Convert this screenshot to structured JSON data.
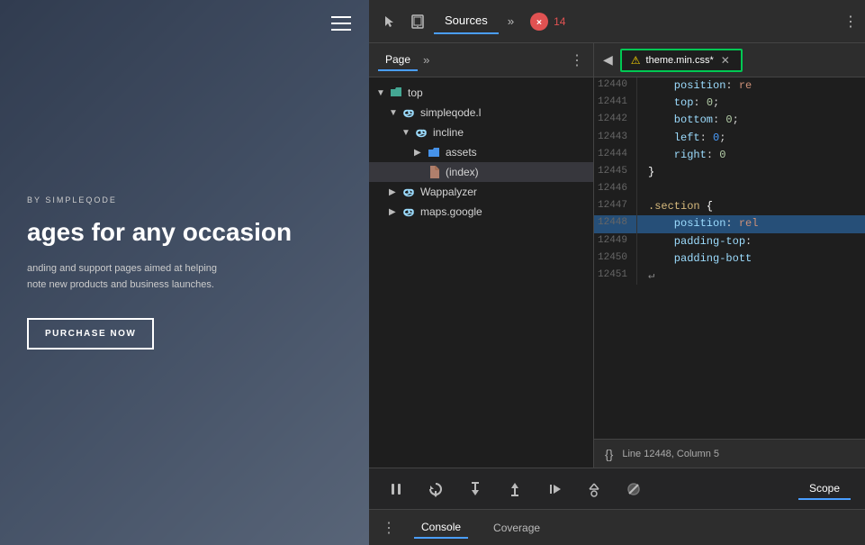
{
  "website": {
    "by_label": "BY SIMPLEQODE",
    "heading": "ages for any occasion",
    "subtext": "anding and support pages aimed at helping\nnote new products and business launches.",
    "btn_label": "PURCHASE NOW"
  },
  "devtools": {
    "toolbar": {
      "sources_tab": "Sources",
      "more_icon": "»",
      "error_icon": "✕",
      "error_count": "14",
      "dots_label": "⋮"
    },
    "file_tree": {
      "tab_page": "Page",
      "more": "»",
      "menu": "⋮",
      "items": [
        {
          "indent": 0,
          "arrow": "▼",
          "icon": "folder",
          "label": "top"
        },
        {
          "indent": 1,
          "arrow": "▼",
          "icon": "cloud",
          "label": "simpleqode.l"
        },
        {
          "indent": 2,
          "arrow": "▼",
          "icon": "cloud",
          "label": "incline"
        },
        {
          "indent": 3,
          "arrow": "▶",
          "icon": "folder-blue",
          "label": "assets"
        },
        {
          "indent": 3,
          "arrow": "",
          "icon": "file",
          "label": "(index)"
        },
        {
          "indent": 1,
          "arrow": "▶",
          "icon": "cloud",
          "label": "Wappalyzer"
        },
        {
          "indent": 1,
          "arrow": "▶",
          "icon": "cloud",
          "label": "maps.google"
        }
      ]
    },
    "code_editor": {
      "tab_label": "theme.min.css*",
      "close_label": "✕",
      "warning_icon": "⚠",
      "lines": [
        {
          "num": "12440",
          "tokens": [
            {
              "type": "prop",
              "text": "    position"
            },
            {
              "type": "punct",
              "text": ": "
            },
            {
              "type": "val-red",
              "text": "re"
            }
          ]
        },
        {
          "num": "12441",
          "tokens": [
            {
              "type": "prop",
              "text": "    top"
            },
            {
              "type": "punct",
              "text": ": "
            },
            {
              "type": "val-num",
              "text": "0"
            },
            {
              "type": "punct",
              "text": ";"
            }
          ]
        },
        {
          "num": "12442",
          "tokens": [
            {
              "type": "prop",
              "text": "    bottom"
            },
            {
              "type": "punct",
              "text": ": "
            },
            {
              "type": "val-num",
              "text": "0"
            },
            {
              "type": "punct",
              "text": ";"
            }
          ]
        },
        {
          "num": "12443",
          "tokens": [
            {
              "type": "prop",
              "text": "    left"
            },
            {
              "type": "punct",
              "text": ": "
            },
            {
              "type": "val-num",
              "text": "0"
            },
            {
              "type": "punct",
              "text": ";"
            }
          ]
        },
        {
          "num": "12444",
          "tokens": [
            {
              "type": "prop",
              "text": "    right"
            },
            {
              "type": "punct",
              "text": ": "
            },
            {
              "type": "val-num",
              "text": "0"
            }
          ]
        },
        {
          "num": "12445",
          "tokens": [
            {
              "type": "brace",
              "text": "}"
            }
          ]
        },
        {
          "num": "12446",
          "tokens": []
        },
        {
          "num": "12447",
          "tokens": [
            {
              "type": "selector",
              "text": ".section"
            },
            {
              "type": "brace",
              "text": " {"
            }
          ]
        },
        {
          "num": "12448",
          "tokens": [
            {
              "type": "prop",
              "text": "    position"
            },
            {
              "type": "punct",
              "text": ": "
            },
            {
              "type": "val-red",
              "text": "rel"
            }
          ]
        },
        {
          "num": "12449",
          "tokens": [
            {
              "type": "prop",
              "text": "    padding-top"
            },
            {
              "type": "punct",
              "text": ":"
            }
          ]
        },
        {
          "num": "12450",
          "tokens": [
            {
              "type": "prop",
              "text": "    padding-bott"
            }
          ]
        },
        {
          "num": "12451",
          "tokens": [
            {
              "type": "val-num",
              "text": "↵"
            }
          ]
        }
      ],
      "status": "Line 12448, Column 5",
      "status_icon": "{}"
    },
    "debugger": {
      "pause_icon": "⏸",
      "step_over_icon": "↺",
      "step_into_icon": "↓",
      "step_out_icon": "↑",
      "step_next_icon": "→",
      "record_icon": "⏺",
      "scope_tab": "Scope"
    },
    "console": {
      "dots": "⋮",
      "tab_console": "Console",
      "tab_coverage": "Coverage"
    }
  }
}
